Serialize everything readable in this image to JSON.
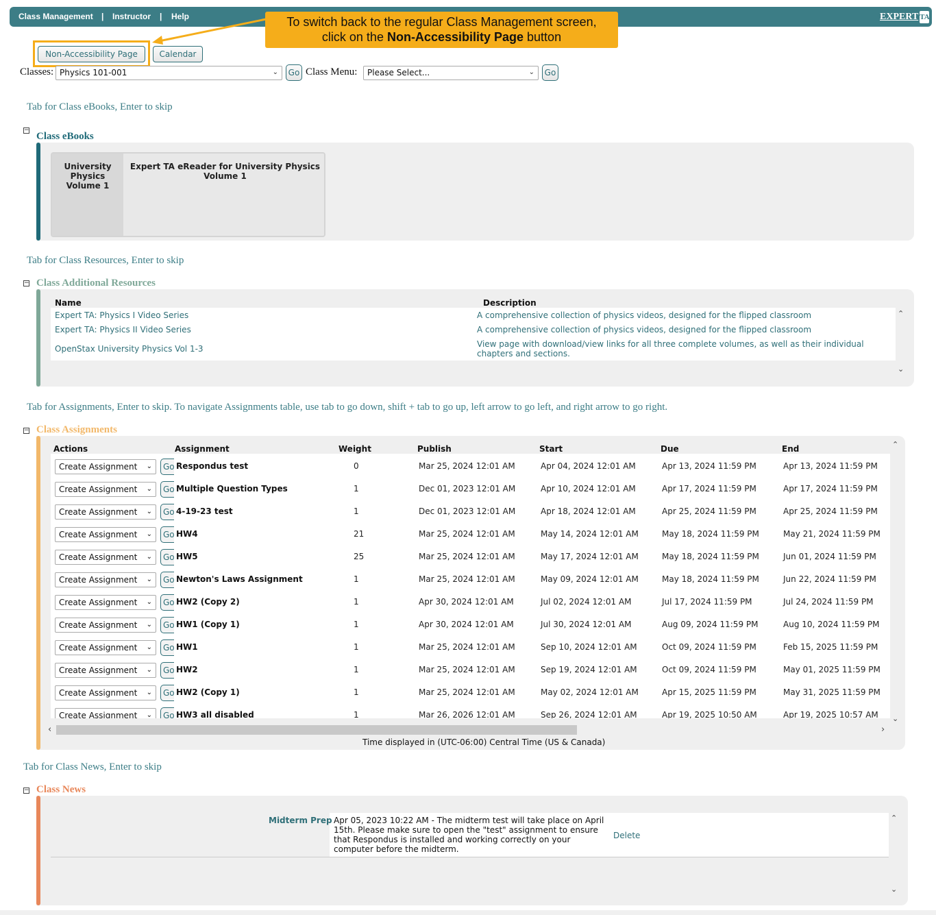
{
  "nav": {
    "items": [
      "Class Management",
      "|",
      "Instructor",
      "|",
      "Help"
    ],
    "logo_text": "EXPERT"
  },
  "callout": {
    "line1": "To switch back to the regular Class Management screen,",
    "line2_prefix": "click on the ",
    "line2_bold": "Non-Accessibility Page",
    "line2_suffix": " button"
  },
  "buttons": {
    "non_accessibility": "Non-Accessibility Page",
    "calendar": "Calendar",
    "go": "Go"
  },
  "classes": {
    "label": "Classes:",
    "value": "Physics 101-001",
    "menu_label": "Class Menu:",
    "menu_value": "Please Select..."
  },
  "skips": {
    "ebooks": "Tab for Class eBooks, Enter to skip",
    "resources": "Tab for Class Resources, Enter to skip",
    "assignments": "Tab for Assignments, Enter to skip. To navigate Assignments table, use tab to go down, shift + tab to go up, left arrow to go left, and right arrow to go right.",
    "news": "Tab for Class News, Enter to skip"
  },
  "ebooks": {
    "title": "Class eBooks",
    "tab1": "University Physics Volume 1",
    "tab2": "Expert TA eReader for University Physics Volume 1"
  },
  "resources": {
    "title": "Class Additional Resources",
    "col_name": "Name",
    "col_desc": "Description",
    "rows": [
      {
        "name": "Expert TA: Physics I Video Series",
        "desc": "A comprehensive collection of physics videos, designed for the flipped classroom"
      },
      {
        "name": "Expert TA: Physics II Video Series",
        "desc": "A comprehensive collection of physics videos, designed for the flipped classroom"
      },
      {
        "name": "OpenStax University Physics Vol 1-3",
        "desc": "View page with download/view links for all three complete volumes, as well as their individual chapters and sections."
      }
    ]
  },
  "assignments": {
    "title": "Class Assignments",
    "headers": [
      "Actions",
      "Assignment",
      "Weight",
      "Publish",
      "Start",
      "Due",
      "End"
    ],
    "action_label": "Create Assignment",
    "go_label": "Go",
    "rows": [
      {
        "name": "Respondus test",
        "weight": "0",
        "publish": "Mar 25, 2024 12:01 AM",
        "start": "Apr 04, 2024 12:01 AM",
        "due": "Apr 13, 2024 11:59 PM",
        "end": "Apr 13, 2024 11:59 PM"
      },
      {
        "name": "Multiple Question Types",
        "weight": "1",
        "publish": "Dec 01, 2023 12:01 AM",
        "start": "Apr 10, 2024 12:01 AM",
        "due": "Apr 17, 2024 11:59 PM",
        "end": "Apr 17, 2024 11:59 PM"
      },
      {
        "name": "4-19-23 test",
        "weight": "1",
        "publish": "Dec 01, 2023 12:01 AM",
        "start": "Apr 18, 2024 12:01 AM",
        "due": "Apr 25, 2024 11:59 PM",
        "end": "Apr 25, 2024 11:59 PM"
      },
      {
        "name": "HW4",
        "weight": "21",
        "publish": "Mar 25, 2024 12:01 AM",
        "start": "May 14, 2024 12:01 AM",
        "due": "May 18, 2024 11:59 PM",
        "end": "May 21, 2024 11:59 PM"
      },
      {
        "name": "HW5",
        "weight": "25",
        "publish": "Mar 25, 2024 12:01 AM",
        "start": "May 17, 2024 12:01 AM",
        "due": "May 18, 2024 11:59 PM",
        "end": "Jun 01, 2024 11:59 PM"
      },
      {
        "name": "Newton's Laws Assignment",
        "weight": "1",
        "publish": "Mar 25, 2024 12:01 AM",
        "start": "May 09, 2024 12:01 AM",
        "due": "May 18, 2024 11:59 PM",
        "end": "Jun 22, 2024 11:59 PM"
      },
      {
        "name": "HW2 (Copy 2)",
        "weight": "1",
        "publish": "Apr 30, 2024 12:01 AM",
        "start": "Jul 02, 2024 12:01 AM",
        "due": "Jul 17, 2024 11:59 PM",
        "end": "Jul 24, 2024 11:59 PM"
      },
      {
        "name": "HW1 (Copy 1)",
        "weight": "1",
        "publish": "Apr 30, 2024 12:01 AM",
        "start": "Jul 30, 2024 12:01 AM",
        "due": "Aug 09, 2024 11:59 PM",
        "end": "Aug 10, 2024 11:59 PM"
      },
      {
        "name": "HW1",
        "weight": "1",
        "publish": "Mar 25, 2024 12:01 AM",
        "start": "Sep 10, 2024 12:01 AM",
        "due": "Oct 09, 2024 11:59 PM",
        "end": "Feb 15, 2025 11:59 PM"
      },
      {
        "name": "HW2",
        "weight": "1",
        "publish": "Mar 25, 2024 12:01 AM",
        "start": "Sep 19, 2024 12:01 AM",
        "due": "Oct 09, 2024 11:59 PM",
        "end": "May 01, 2025 11:59 PM"
      },
      {
        "name": "HW2 (Copy 1)",
        "weight": "1",
        "publish": "Mar 25, 2024 12:01 AM",
        "start": "May 02, 2024 12:01 AM",
        "due": "Apr 15, 2025 11:59 PM",
        "end": "May 31, 2025 11:59 PM"
      },
      {
        "name": "HW3 all disabled",
        "weight": "1",
        "publish": "Mar 26, 2026 12:01 AM",
        "start": "Sep 26, 2024 12:01 AM",
        "due": "Apr 19, 2025 10:50 AM",
        "end": "Apr 19, 2025 10:57 AM"
      }
    ],
    "timezone": "Time displayed in (UTC-06:00) Central Time (US & Canada)"
  },
  "news": {
    "title": "Class News",
    "item_title": "Midterm Prep",
    "item_body": "Apr 05, 2023 10:22 AM - The midterm test will take place on April 15th. Please make sure to open the \"test\" assignment to ensure that Respondus is installed and working correctly on your computer before the midterm.",
    "delete": "Delete"
  },
  "colors": {
    "teal": "#3c7d86",
    "ebooks_bar": "#1f6a78",
    "resources_bar": "#7fa898",
    "assignments": "#f2b86a",
    "news": "#e8875a",
    "callout": "#f5ad1a"
  },
  "icons": [
    "collapse-icon",
    "chevron-down-icon",
    "scroll-up-icon",
    "scroll-down-icon",
    "scroll-left-icon",
    "scroll-right-icon"
  ]
}
